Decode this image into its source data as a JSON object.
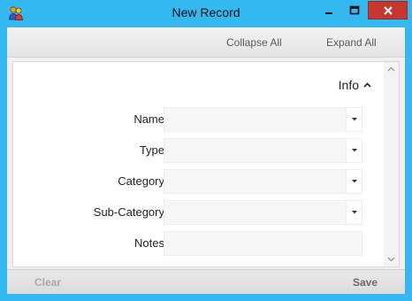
{
  "window": {
    "title": "New Record",
    "app_icon": "people-icon",
    "controls": [
      "minimize-icon",
      "maximize-icon",
      "close-icon"
    ],
    "accent_color": "#33b8f2",
    "close_color": "#c7372f"
  },
  "toolbar": {
    "collapse_all_label": "Collapse All",
    "expand_all_label": "Expand All"
  },
  "section": {
    "title": "Info",
    "state_icon": "chevron-up-icon"
  },
  "form": {
    "name": {
      "label": "Name",
      "value": ""
    },
    "type": {
      "label": "Type",
      "value": ""
    },
    "category": {
      "label": "Category",
      "value": ""
    },
    "sub_category": {
      "label": "Sub-Category",
      "value": ""
    },
    "notes": {
      "label": "Notes",
      "value": ""
    }
  },
  "footer": {
    "clear_label": "Clear",
    "save_label": "Save"
  }
}
